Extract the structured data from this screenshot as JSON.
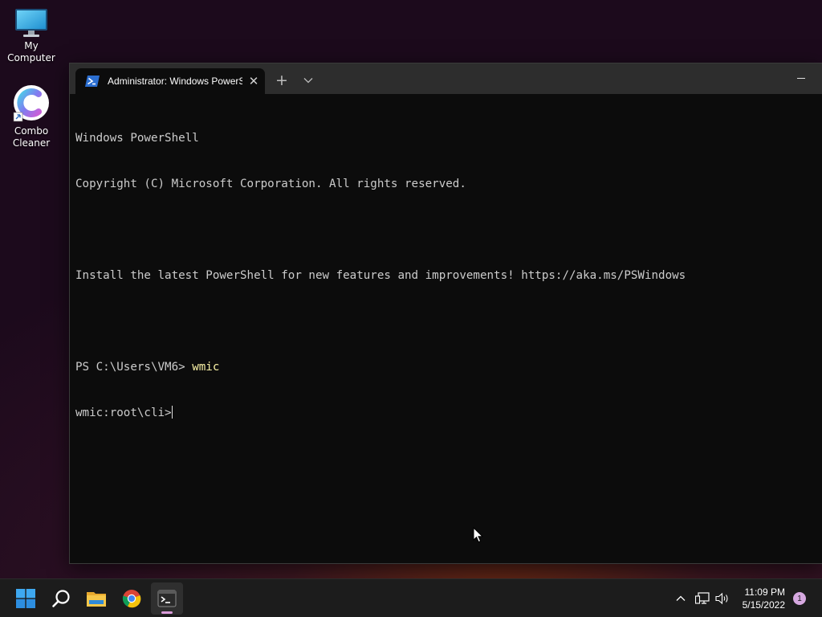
{
  "desktop": {
    "icons": [
      {
        "label": "My Computer"
      },
      {
        "label": "Combo\nCleaner"
      }
    ]
  },
  "terminal": {
    "tab_title": "Administrator: Windows PowerShell",
    "lines": [
      "Windows PowerShell",
      "Copyright (C) Microsoft Corporation. All rights reserved.",
      "",
      "Install the latest PowerShell for new features and improvements! https://aka.ms/PSWindows",
      ""
    ],
    "prompt": "PS C:\\Users\\VM6> ",
    "command": "wmic",
    "current_prompt": "wmic:root\\cli>"
  },
  "taskbar": {
    "buttons": [
      "start-icon",
      "search-icon",
      "file-explorer-icon",
      "chrome-icon",
      "terminal-icon"
    ],
    "active": "terminal-icon"
  },
  "tray": {
    "time": "11:09 PM",
    "date": "5/15/2022",
    "notification_count": "1"
  },
  "colors": {
    "terminal_bg": "#0c0c0c",
    "tabbar_bg": "#2d2d2d",
    "command_yellow": "#f9f1a5",
    "taskbar_bg": "#1c1c1c",
    "accent_pink": "#d99bd9"
  }
}
